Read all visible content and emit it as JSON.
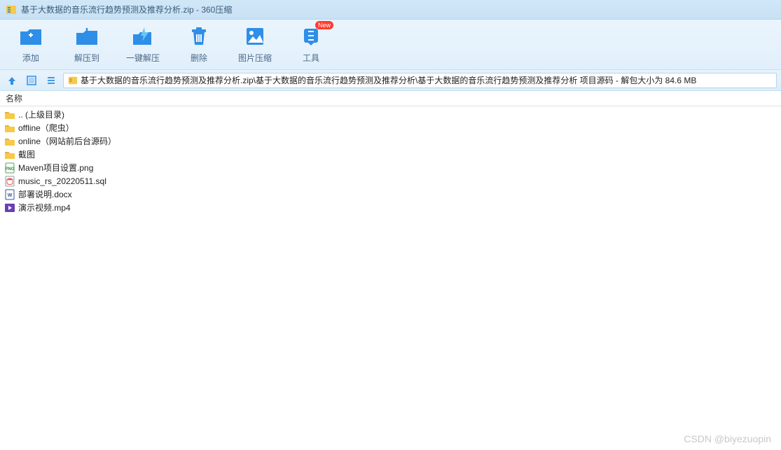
{
  "window": {
    "title": "基于大数据的音乐流行趋势预测及推荐分析.zip - 360压缩"
  },
  "toolbar": {
    "add": "添加",
    "extract_to": "解压到",
    "one_click_extract": "一键解压",
    "delete": "删除",
    "image_compress": "图片压缩",
    "tools": "工具",
    "new_badge": "New"
  },
  "path": "基于大数据的音乐流行趋势预测及推荐分析.zip\\基于大数据的音乐流行趋势预测及推荐分析\\基于大数据的音乐流行趋势预测及推荐分析 项目源码 - 解包大小为 84.6 MB",
  "column_header": "名称",
  "files": [
    {
      "icon": "folder",
      "name": ".. (上级目录)"
    },
    {
      "icon": "folder",
      "name": "offline（爬虫）"
    },
    {
      "icon": "folder",
      "name": "online（网站前后台源码）"
    },
    {
      "icon": "folder",
      "name": "截图"
    },
    {
      "icon": "png",
      "name": "Maven项目设置.png"
    },
    {
      "icon": "sql",
      "name": "music_rs_20220511.sql"
    },
    {
      "icon": "docx",
      "name": "部署说明.docx"
    },
    {
      "icon": "mp4",
      "name": "演示视频.mp4"
    }
  ],
  "watermark": "CSDN @biyezuopin"
}
